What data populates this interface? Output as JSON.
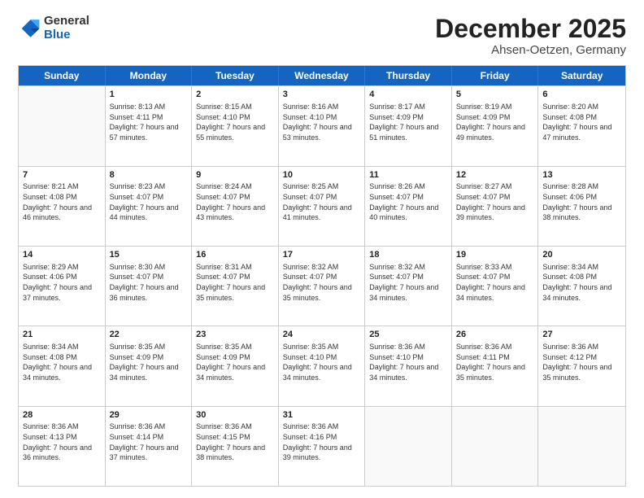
{
  "header": {
    "logo_general": "General",
    "logo_blue": "Blue",
    "month_title": "December 2025",
    "subtitle": "Ahsen-Oetzen, Germany"
  },
  "days_of_week": [
    "Sunday",
    "Monday",
    "Tuesday",
    "Wednesday",
    "Thursday",
    "Friday",
    "Saturday"
  ],
  "rows": [
    [
      {
        "day": "",
        "empty": true
      },
      {
        "day": "1",
        "sunrise": "Sunrise: 8:13 AM",
        "sunset": "Sunset: 4:11 PM",
        "daylight": "Daylight: 7 hours and 57 minutes."
      },
      {
        "day": "2",
        "sunrise": "Sunrise: 8:15 AM",
        "sunset": "Sunset: 4:10 PM",
        "daylight": "Daylight: 7 hours and 55 minutes."
      },
      {
        "day": "3",
        "sunrise": "Sunrise: 8:16 AM",
        "sunset": "Sunset: 4:10 PM",
        "daylight": "Daylight: 7 hours and 53 minutes."
      },
      {
        "day": "4",
        "sunrise": "Sunrise: 8:17 AM",
        "sunset": "Sunset: 4:09 PM",
        "daylight": "Daylight: 7 hours and 51 minutes."
      },
      {
        "day": "5",
        "sunrise": "Sunrise: 8:19 AM",
        "sunset": "Sunset: 4:09 PM",
        "daylight": "Daylight: 7 hours and 49 minutes."
      },
      {
        "day": "6",
        "sunrise": "Sunrise: 8:20 AM",
        "sunset": "Sunset: 4:08 PM",
        "daylight": "Daylight: 7 hours and 47 minutes."
      }
    ],
    [
      {
        "day": "7",
        "sunrise": "Sunrise: 8:21 AM",
        "sunset": "Sunset: 4:08 PM",
        "daylight": "Daylight: 7 hours and 46 minutes."
      },
      {
        "day": "8",
        "sunrise": "Sunrise: 8:23 AM",
        "sunset": "Sunset: 4:07 PM",
        "daylight": "Daylight: 7 hours and 44 minutes."
      },
      {
        "day": "9",
        "sunrise": "Sunrise: 8:24 AM",
        "sunset": "Sunset: 4:07 PM",
        "daylight": "Daylight: 7 hours and 43 minutes."
      },
      {
        "day": "10",
        "sunrise": "Sunrise: 8:25 AM",
        "sunset": "Sunset: 4:07 PM",
        "daylight": "Daylight: 7 hours and 41 minutes."
      },
      {
        "day": "11",
        "sunrise": "Sunrise: 8:26 AM",
        "sunset": "Sunset: 4:07 PM",
        "daylight": "Daylight: 7 hours and 40 minutes."
      },
      {
        "day": "12",
        "sunrise": "Sunrise: 8:27 AM",
        "sunset": "Sunset: 4:07 PM",
        "daylight": "Daylight: 7 hours and 39 minutes."
      },
      {
        "day": "13",
        "sunrise": "Sunrise: 8:28 AM",
        "sunset": "Sunset: 4:06 PM",
        "daylight": "Daylight: 7 hours and 38 minutes."
      }
    ],
    [
      {
        "day": "14",
        "sunrise": "Sunrise: 8:29 AM",
        "sunset": "Sunset: 4:06 PM",
        "daylight": "Daylight: 7 hours and 37 minutes."
      },
      {
        "day": "15",
        "sunrise": "Sunrise: 8:30 AM",
        "sunset": "Sunset: 4:07 PM",
        "daylight": "Daylight: 7 hours and 36 minutes."
      },
      {
        "day": "16",
        "sunrise": "Sunrise: 8:31 AM",
        "sunset": "Sunset: 4:07 PM",
        "daylight": "Daylight: 7 hours and 35 minutes."
      },
      {
        "day": "17",
        "sunrise": "Sunrise: 8:32 AM",
        "sunset": "Sunset: 4:07 PM",
        "daylight": "Daylight: 7 hours and 35 minutes."
      },
      {
        "day": "18",
        "sunrise": "Sunrise: 8:32 AM",
        "sunset": "Sunset: 4:07 PM",
        "daylight": "Daylight: 7 hours and 34 minutes."
      },
      {
        "day": "19",
        "sunrise": "Sunrise: 8:33 AM",
        "sunset": "Sunset: 4:07 PM",
        "daylight": "Daylight: 7 hours and 34 minutes."
      },
      {
        "day": "20",
        "sunrise": "Sunrise: 8:34 AM",
        "sunset": "Sunset: 4:08 PM",
        "daylight": "Daylight: 7 hours and 34 minutes."
      }
    ],
    [
      {
        "day": "21",
        "sunrise": "Sunrise: 8:34 AM",
        "sunset": "Sunset: 4:08 PM",
        "daylight": "Daylight: 7 hours and 34 minutes."
      },
      {
        "day": "22",
        "sunrise": "Sunrise: 8:35 AM",
        "sunset": "Sunset: 4:09 PM",
        "daylight": "Daylight: 7 hours and 34 minutes."
      },
      {
        "day": "23",
        "sunrise": "Sunrise: 8:35 AM",
        "sunset": "Sunset: 4:09 PM",
        "daylight": "Daylight: 7 hours and 34 minutes."
      },
      {
        "day": "24",
        "sunrise": "Sunrise: 8:35 AM",
        "sunset": "Sunset: 4:10 PM",
        "daylight": "Daylight: 7 hours and 34 minutes."
      },
      {
        "day": "25",
        "sunrise": "Sunrise: 8:36 AM",
        "sunset": "Sunset: 4:10 PM",
        "daylight": "Daylight: 7 hours and 34 minutes."
      },
      {
        "day": "26",
        "sunrise": "Sunrise: 8:36 AM",
        "sunset": "Sunset: 4:11 PM",
        "daylight": "Daylight: 7 hours and 35 minutes."
      },
      {
        "day": "27",
        "sunrise": "Sunrise: 8:36 AM",
        "sunset": "Sunset: 4:12 PM",
        "daylight": "Daylight: 7 hours and 35 minutes."
      }
    ],
    [
      {
        "day": "28",
        "sunrise": "Sunrise: 8:36 AM",
        "sunset": "Sunset: 4:13 PM",
        "daylight": "Daylight: 7 hours and 36 minutes."
      },
      {
        "day": "29",
        "sunrise": "Sunrise: 8:36 AM",
        "sunset": "Sunset: 4:14 PM",
        "daylight": "Daylight: 7 hours and 37 minutes."
      },
      {
        "day": "30",
        "sunrise": "Sunrise: 8:36 AM",
        "sunset": "Sunset: 4:15 PM",
        "daylight": "Daylight: 7 hours and 38 minutes."
      },
      {
        "day": "31",
        "sunrise": "Sunrise: 8:36 AM",
        "sunset": "Sunset: 4:16 PM",
        "daylight": "Daylight: 7 hours and 39 minutes."
      },
      {
        "day": "",
        "empty": true
      },
      {
        "day": "",
        "empty": true
      },
      {
        "day": "",
        "empty": true
      }
    ]
  ]
}
